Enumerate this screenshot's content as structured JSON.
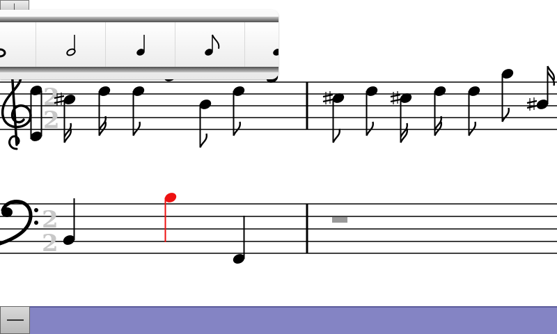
{
  "colors": {
    "note": "#000000",
    "selected_note": "#ee1111",
    "time_signature": "#c8c8c8",
    "rest": "#999999",
    "toolbar": "#8484c4"
  },
  "palette": {
    "items": [
      {
        "name": "whole-note-icon"
      },
      {
        "name": "half-note-icon"
      },
      {
        "name": "quarter-note-icon"
      },
      {
        "name": "eighth-note-icon"
      },
      {
        "name": "sixteenth-note-icon"
      }
    ]
  },
  "treble_staff": {
    "clef": "treble",
    "time_signature": {
      "top": "2",
      "bottom": "2"
    }
  },
  "bass_staff": {
    "clef": "bass",
    "time_signature": {
      "top": "2",
      "bottom": "2"
    }
  },
  "icons": {
    "corner_button": "pipe-icon",
    "minus_button": "minus-icon"
  }
}
